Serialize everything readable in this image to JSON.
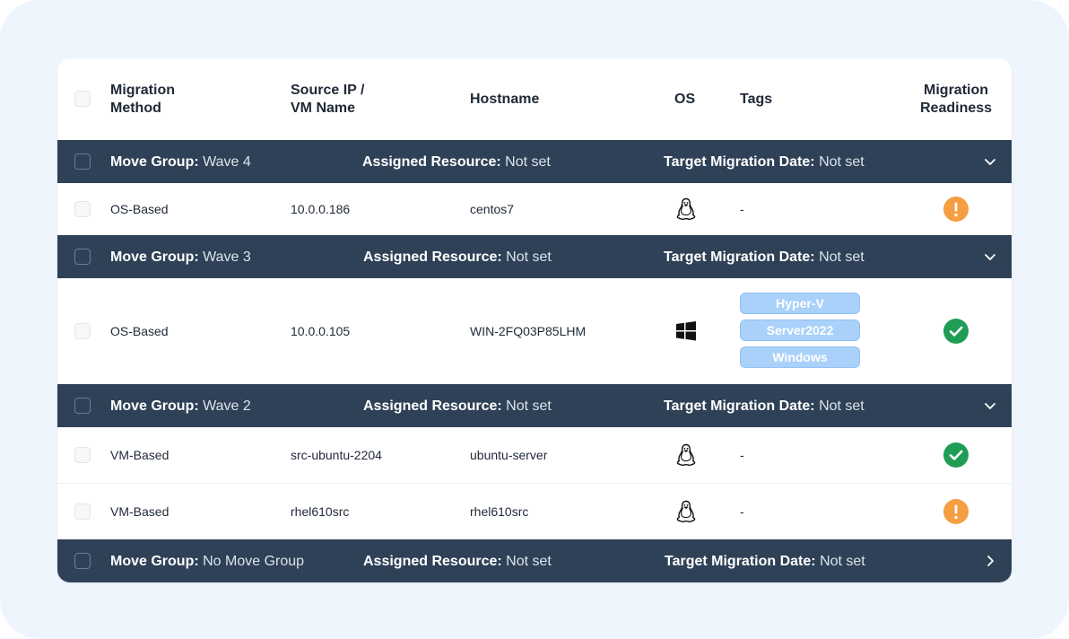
{
  "columns": {
    "method": "Migration\nMethod",
    "source": "Source IP /\nVM Name",
    "hostname": "Hostname",
    "os": "OS",
    "tags": "Tags",
    "readiness": "Migration\nReadiness"
  },
  "group_labels": {
    "move_group": "Move Group:",
    "assigned_resource": "Assigned Resource:",
    "target_date": "Target Migration Date:"
  },
  "groups": [
    {
      "name": "Wave 4",
      "resource": "Not set",
      "date": "Not set",
      "expanded": true
    },
    {
      "name": "Wave 3",
      "resource": "Not set",
      "date": "Not set",
      "expanded": true
    },
    {
      "name": "Wave 2",
      "resource": "Not set",
      "date": "Not set",
      "expanded": true
    },
    {
      "name": "No Move Group",
      "resource": "Not set",
      "date": "Not set",
      "expanded": false
    }
  ],
  "rows": [
    {
      "method": "OS-Based",
      "source": "10.0.0.186",
      "hostname": "centos7",
      "os": "linux-icon",
      "tags_text": "-",
      "readiness": "warning"
    },
    {
      "method": "OS-Based",
      "source": "10.0.0.105",
      "hostname": "WIN-2FQ03P85LHM",
      "os": "windows-icon",
      "tags": [
        "Hyper-V",
        "Server2022",
        "Windows"
      ],
      "readiness": "ready"
    },
    {
      "method": "VM-Based",
      "source": "src-ubuntu-2204",
      "hostname": "ubuntu-server",
      "os": "linux-icon",
      "tags_text": "-",
      "readiness": "ready"
    },
    {
      "method": "VM-Based",
      "source": "rhel610src",
      "hostname": "rhel610src",
      "os": "linux-icon",
      "tags_text": "-",
      "readiness": "warning"
    }
  ],
  "colors": {
    "group_bg": "#2e4156",
    "ready": "#1f9d55",
    "warning": "#f59e42",
    "tag_bg": "#a9d1fa"
  }
}
